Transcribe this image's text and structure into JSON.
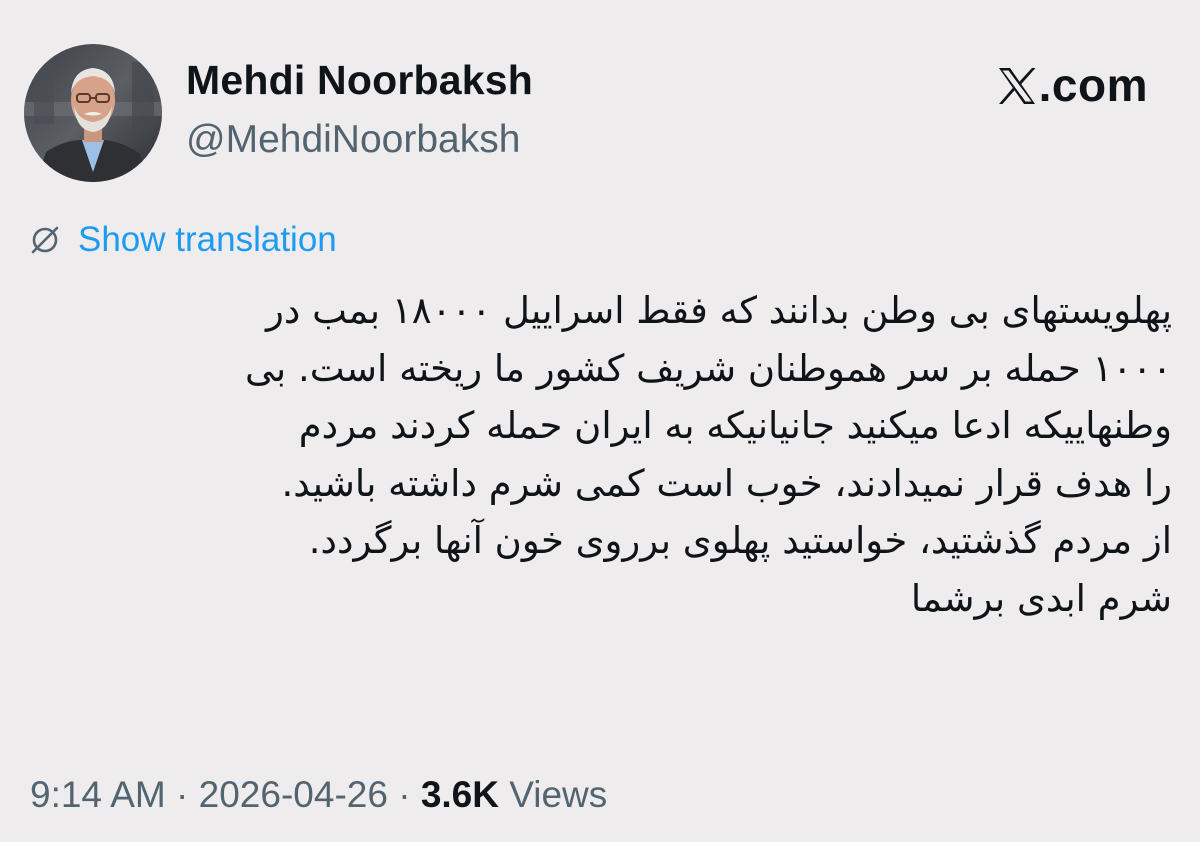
{
  "author": {
    "name": "Mehdi Noorbaksh",
    "handle": "@MehdiNoorbaksh",
    "avatar_icon": "profile-photo"
  },
  "brand": {
    "text": ".com",
    "icon": "x-logo-icon"
  },
  "translation": {
    "label": "Show translation",
    "icon": "globe-slash-icon",
    "color": "#1d9bf0"
  },
  "tweet": {
    "lines": [
      "پهلویستهای بی وطن بدانند که فقط اسراییل ۱۸۰۰۰ بمب در",
      "۱۰۰۰ حمله بر سر هموطنان شریف کشور ما ریخته است. بی",
      "وطنهاییکه ادعا میکنید جانیانیکه به ایران حمله کردند مردم",
      "را هدف قرار نمیدادند، خوب است کمی شرم داشته باشید.",
      "از مردم گذشتید، خواستید پهلوی برروی خون آنها برگردد.",
      "شرم ابدی برشما"
    ]
  },
  "meta": {
    "time": "9:14 AM",
    "separator": " · ",
    "date": "2026-04-26",
    "views_count": "3.6K",
    "views_label": " Views"
  },
  "colors": {
    "background": "#eeeced",
    "text": "#0f1419",
    "secondary": "#536471"
  }
}
